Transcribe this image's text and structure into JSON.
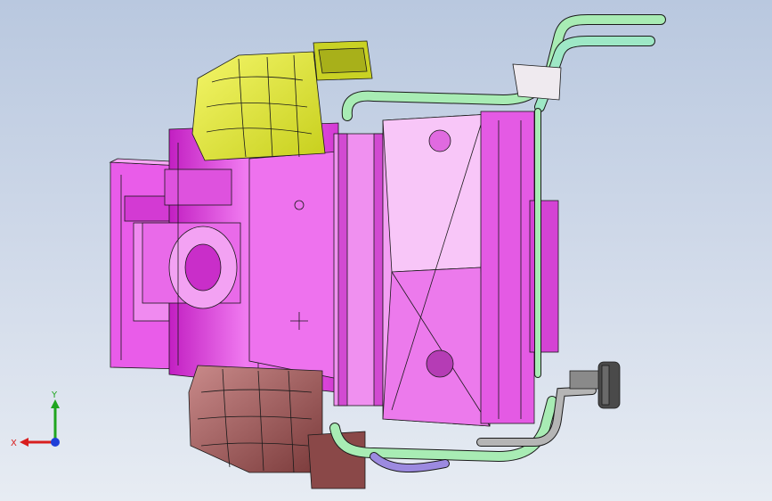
{
  "viewport": {
    "background_top": "#b9c8df",
    "background_bottom": "#e7ecf3"
  },
  "model": {
    "colors": {
      "housing": "#e64ce6",
      "housing_light": "#f6a8f4",
      "housing_dark": "#9e1f9e",
      "duct_yellow": "#e8f03a",
      "duct_brown": "#9d5a5a",
      "pipe_green": "#a8ecb4",
      "pipe_gray": "#b5b5b5",
      "knob": "#4a4a4a",
      "edge": "#1a1a1a"
    }
  },
  "triad": {
    "x_label": "X",
    "y_label": "Y",
    "x_color": "#d81e1e",
    "y_color": "#1fa51f",
    "z_color": "#1f3fd8"
  }
}
